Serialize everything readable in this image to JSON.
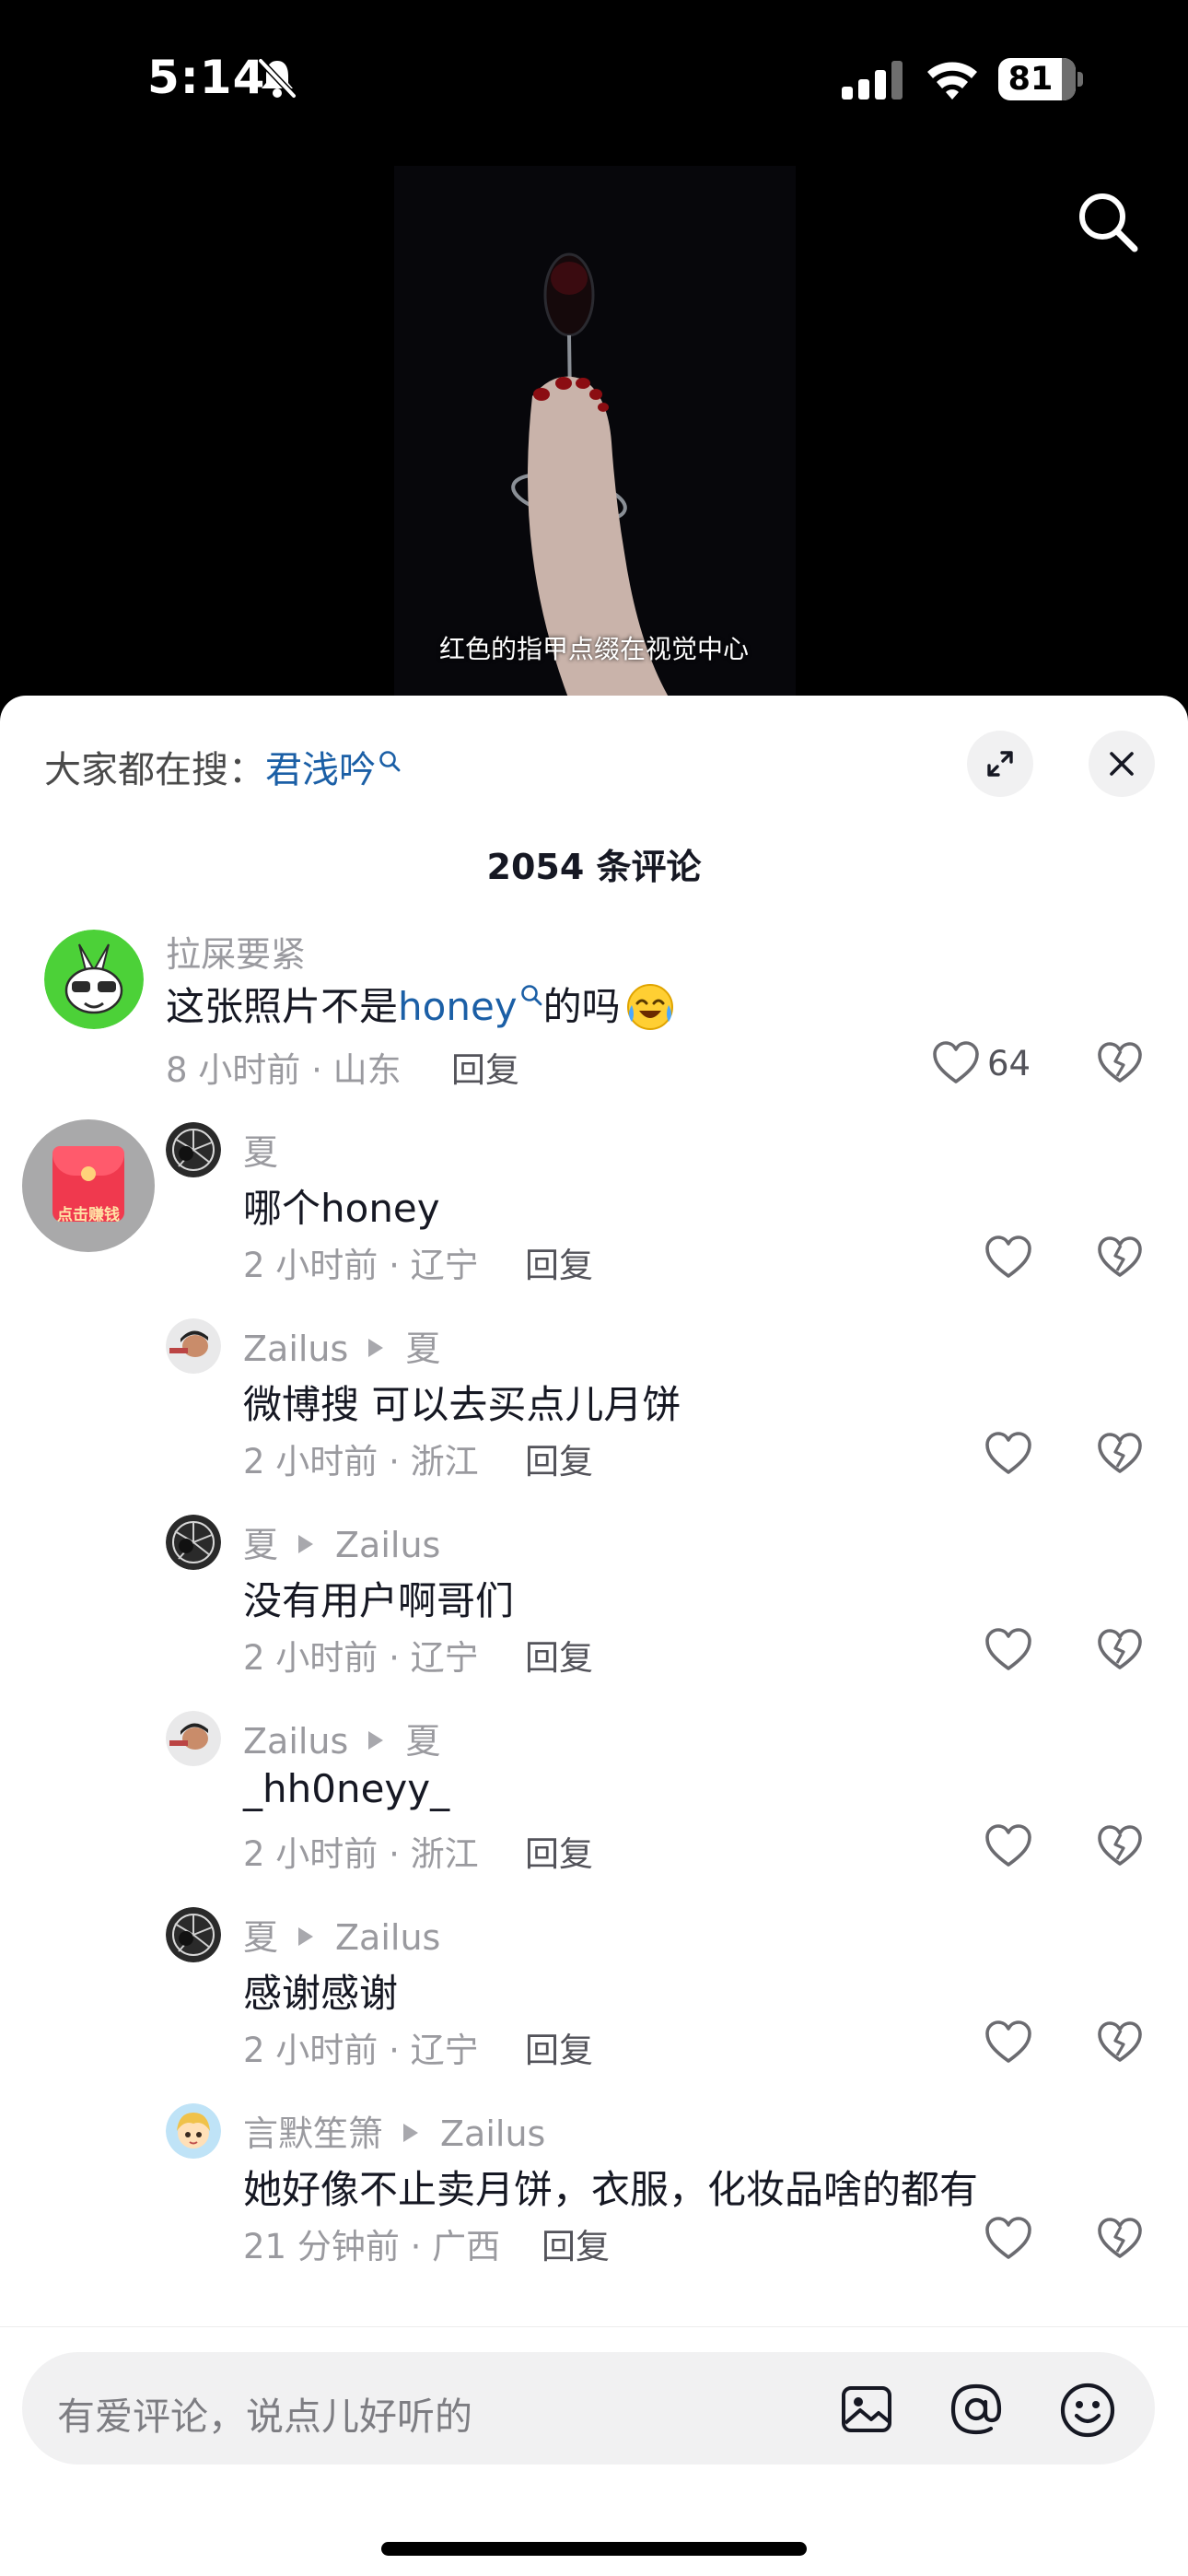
{
  "status_bar": {
    "time": "5:14",
    "battery": "81"
  },
  "video": {
    "subtitle": "红色的指甲点缀在视觉中心"
  },
  "panel": {
    "trending_prefix": "大家都在搜：",
    "trending_term": "君浅吟",
    "comment_count": "2054 条评论",
    "reply_label": "回复"
  },
  "comments": [
    {
      "user": "拉屎要紧",
      "text_before": "这张照片不是",
      "link": "honey",
      "text_after": "的吗",
      "meta": "8 小时前 · 山东",
      "likes": "64"
    },
    {
      "user": "夏",
      "text": "哪个honey",
      "meta": "2 小时前 · 辽宁"
    },
    {
      "user": "Zailus",
      "reply_to": "夏",
      "text": "微博搜 可以去买点儿月饼",
      "meta": "2 小时前 · 浙江"
    },
    {
      "user": "夏",
      "reply_to": "Zailus",
      "text": "没有用户啊哥们",
      "meta": "2 小时前 · 辽宁"
    },
    {
      "user": "Zailus",
      "reply_to": "夏",
      "text": "_hh0neyy_",
      "meta": "2 小时前 · 浙江"
    },
    {
      "user": "夏",
      "reply_to": "Zailus",
      "text": "感谢感谢",
      "meta": "2 小时前 · 辽宁"
    },
    {
      "user": "言默笙箫",
      "reply_to": "Zailus",
      "text": "她好像不止卖月饼，衣服，化妆品啥的都有",
      "meta": "21 分钟前 · 广西"
    }
  ],
  "red_packet": {
    "label": "点击赚钱"
  },
  "input": {
    "placeholder": "有爱评论，说点儿好听的"
  }
}
